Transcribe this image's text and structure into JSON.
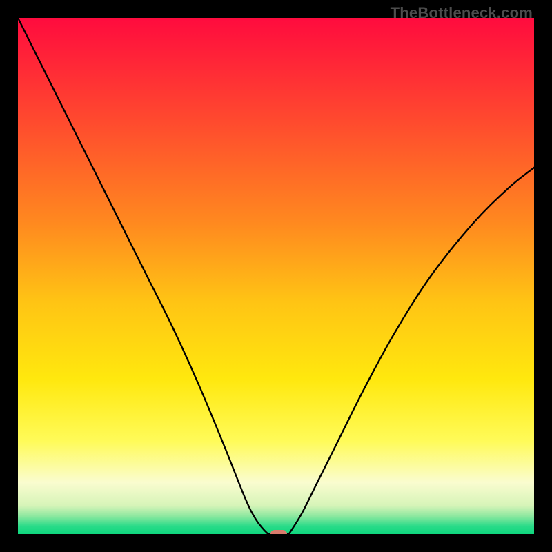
{
  "watermark": "TheBottleneck.com",
  "colors": {
    "black": "#000000",
    "curve": "#000000",
    "pill": "#d97b6c",
    "watermark": "#4d4d4d"
  },
  "chart_data": {
    "type": "line",
    "title": "",
    "xlabel": "",
    "ylabel": "",
    "xlim": [
      0,
      100
    ],
    "ylim": [
      0,
      100
    ],
    "grid": false,
    "gradient_stops": [
      {
        "pos": 0.0,
        "color": "#ff0b3e"
      },
      {
        "pos": 0.2,
        "color": "#ff4a2e"
      },
      {
        "pos": 0.4,
        "color": "#ff8a1f"
      },
      {
        "pos": 0.55,
        "color": "#ffc414"
      },
      {
        "pos": 0.7,
        "color": "#ffe80e"
      },
      {
        "pos": 0.82,
        "color": "#fffb59"
      },
      {
        "pos": 0.9,
        "color": "#fafccf"
      },
      {
        "pos": 0.945,
        "color": "#d6f4b8"
      },
      {
        "pos": 0.965,
        "color": "#8ee8a0"
      },
      {
        "pos": 0.985,
        "color": "#29db89"
      },
      {
        "pos": 1.0,
        "color": "#0ed77e"
      }
    ],
    "series": [
      {
        "name": "left-branch",
        "x": [
          0,
          5,
          10,
          15,
          20,
          25,
          30,
          35,
          40,
          44,
          46,
          47.5,
          48.5
        ],
        "y": [
          100,
          90,
          80,
          70,
          60,
          50,
          40,
          29,
          17,
          7,
          3,
          1,
          0
        ]
      },
      {
        "name": "floor",
        "x": [
          48.5,
          52.5
        ],
        "y": [
          0,
          0
        ]
      },
      {
        "name": "right-branch",
        "x": [
          52.5,
          55,
          58,
          62,
          67,
          73,
          80,
          88,
          95,
          100
        ],
        "y": [
          0,
          4,
          10,
          18,
          28,
          39,
          50,
          60,
          67,
          71
        ]
      }
    ],
    "marker": {
      "name": "optimum-pill",
      "x": 50.5,
      "y": 0,
      "color": "#d97b6c"
    }
  }
}
